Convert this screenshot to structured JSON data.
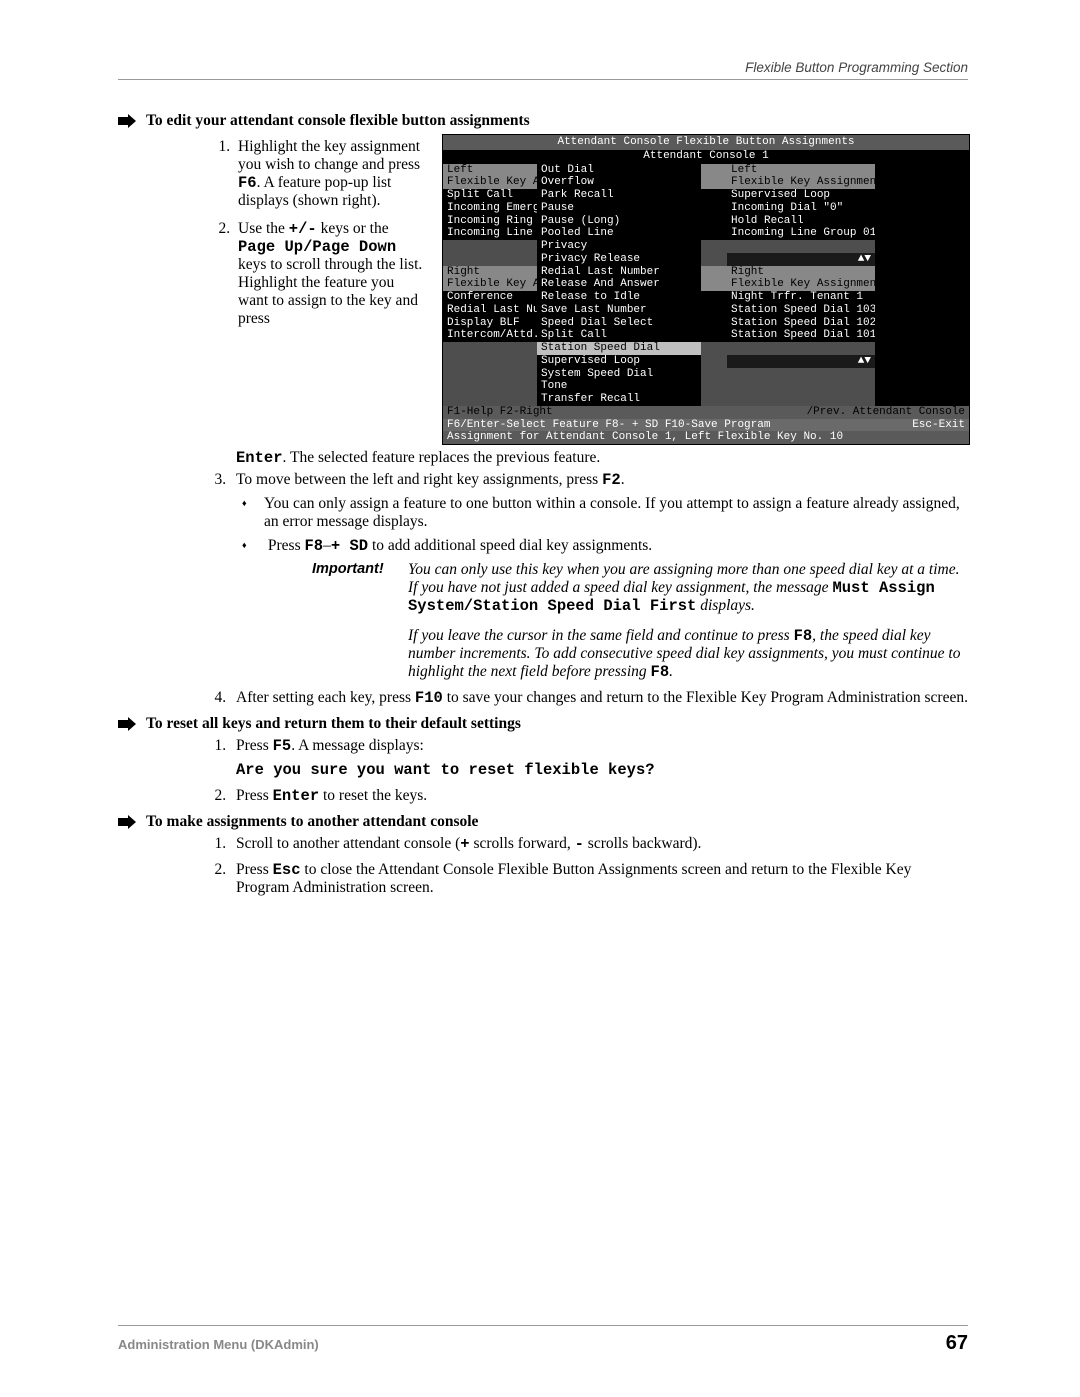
{
  "running_head": "Flexible Button Programming Section",
  "footer": {
    "left": "Administration Menu (DKAdmin)",
    "page": "67"
  },
  "sec1": {
    "title": "To edit your attendant console flexible button assignments",
    "step1": {
      "a": "Highlight the key assignment you wish to change and press ",
      "b": "F6",
      "c": ". A feature pop-up list displays (shown right)."
    },
    "step2": {
      "a": "Use the ",
      "b": "+/-",
      "c": " keys or the ",
      "d": "Page Up/Page Down",
      "e": " keys to scroll through the list. Highlight the feature you want to assign to the key and press ",
      "f": "Enter",
      "g": ". The selected feature replaces the previous feature."
    },
    "step3": {
      "a": "To move between the left and right key assignments, press ",
      "b": "F2",
      "c": "."
    },
    "step3_b1": "You can only assign a feature to one button within a console. If you attempt to assign a feature already assigned, an error message displays.",
    "step3_b2": {
      "a": "Press ",
      "b": "F8",
      "c": "–",
      "d": "+ SD",
      "e": " to add additional speed dial key assignments."
    },
    "important_label": "Important!",
    "important1": {
      "a": "You can only use this key when you are assigning more than one speed dial key at a time. If you have not just added a speed dial key assignment, the message ",
      "b": "Must Assign System/Station Speed Dial First",
      "c": " displays."
    },
    "important2": {
      "a": "If you leave the cursor in the same field and continue to press ",
      "b": "F8",
      "c": ", the speed dial key number increments. To add consecutive speed dial key assignments, you must continue to highlight the next field before pressing ",
      "d": "F8",
      "e": "."
    },
    "step4": {
      "a": "After setting each key, press ",
      "b": "F10",
      "c": " to save your changes and return to the Flexible Key Program Administration screen."
    }
  },
  "sec2": {
    "title": "To reset all keys and return them to their default settings",
    "step1": {
      "a": "Press ",
      "b": "F5",
      "c": ". A message displays:"
    },
    "msg": "Are you sure you want to reset flexible keys?",
    "step2": {
      "a": "Press ",
      "b": "Enter",
      "c": " to reset the keys."
    }
  },
  "sec3": {
    "title": "To make assignments to another attendant console",
    "step1": {
      "a": "Scroll to another attendant console (",
      "b": "+",
      "c": " scrolls forward, ",
      "d": "-",
      "e": "  scrolls backward)."
    },
    "step2": {
      "a": "Press ",
      "b": "Esc",
      "c": " to close the Attendant Console Flexible Button Assignments screen and return to the Flexible Key Program Administration screen."
    }
  },
  "console": {
    "title": "Attendant Console Flexible Button Assignments",
    "subtitle": "Attendant Console 1",
    "left_hdr1": "Left",
    "left_hdr2": "Flexible Key As",
    "right_hdr1": "Left",
    "right_hdr2": "Flexible Key Assignment",
    "popup_before_hl": [
      "Out Dial",
      "Overflow",
      "Park Recall",
      "Pause",
      "Pause (Long)",
      "Pooled Line",
      "Privacy",
      "Privacy Release",
      "Redial Last Number",
      "Release And Answer",
      "Release to Idle",
      "Save Last Number",
      "Speed Dial Select",
      "Split Call"
    ],
    "popup_hl": "Station Speed Dial",
    "popup_after_hl": [
      "Supervised Loop",
      "System Speed Dial",
      "Tone",
      "Transfer Recall"
    ],
    "left_keys_top": [
      "Split Call",
      "Incoming Emerge",
      "Incoming Ring T",
      "Incoming Line G"
    ],
    "right_vals_top": [
      "Supervised Loop",
      "Incoming Dial \"0\"",
      "Hold Recall",
      "Incoming Line Group 01"
    ],
    "left_btm_hdr1": "Right",
    "left_btm_hdr2": "Flexible Key As",
    "right_btm_hdr1": "Right",
    "right_btm_hdr2": "Flexible Key Assignment",
    "left_keys_btm": [
      "Conference",
      "Redial Last Num",
      "Display BLF",
      "Intercom/Attd."
    ],
    "right_vals_btm": [
      "Night Trfr. Tenant 1",
      "Station Speed Dial 103",
      "Station Speed Dial 102",
      "Station Speed Dial 101"
    ],
    "arrows1": "▲▼",
    "arrows2": "▲▼",
    "bot1_l": "F1-Help  F2-Right",
    "bot1_r": "/Prev. Attendant Console",
    "bot2_l": "F6/Enter-Select Feature  F8- + SD  F10-Save Program",
    "bot2_r": "Esc-Exit",
    "bot3": "Assignment for Attendant Console 1, Left Flexible Key No. 10"
  }
}
